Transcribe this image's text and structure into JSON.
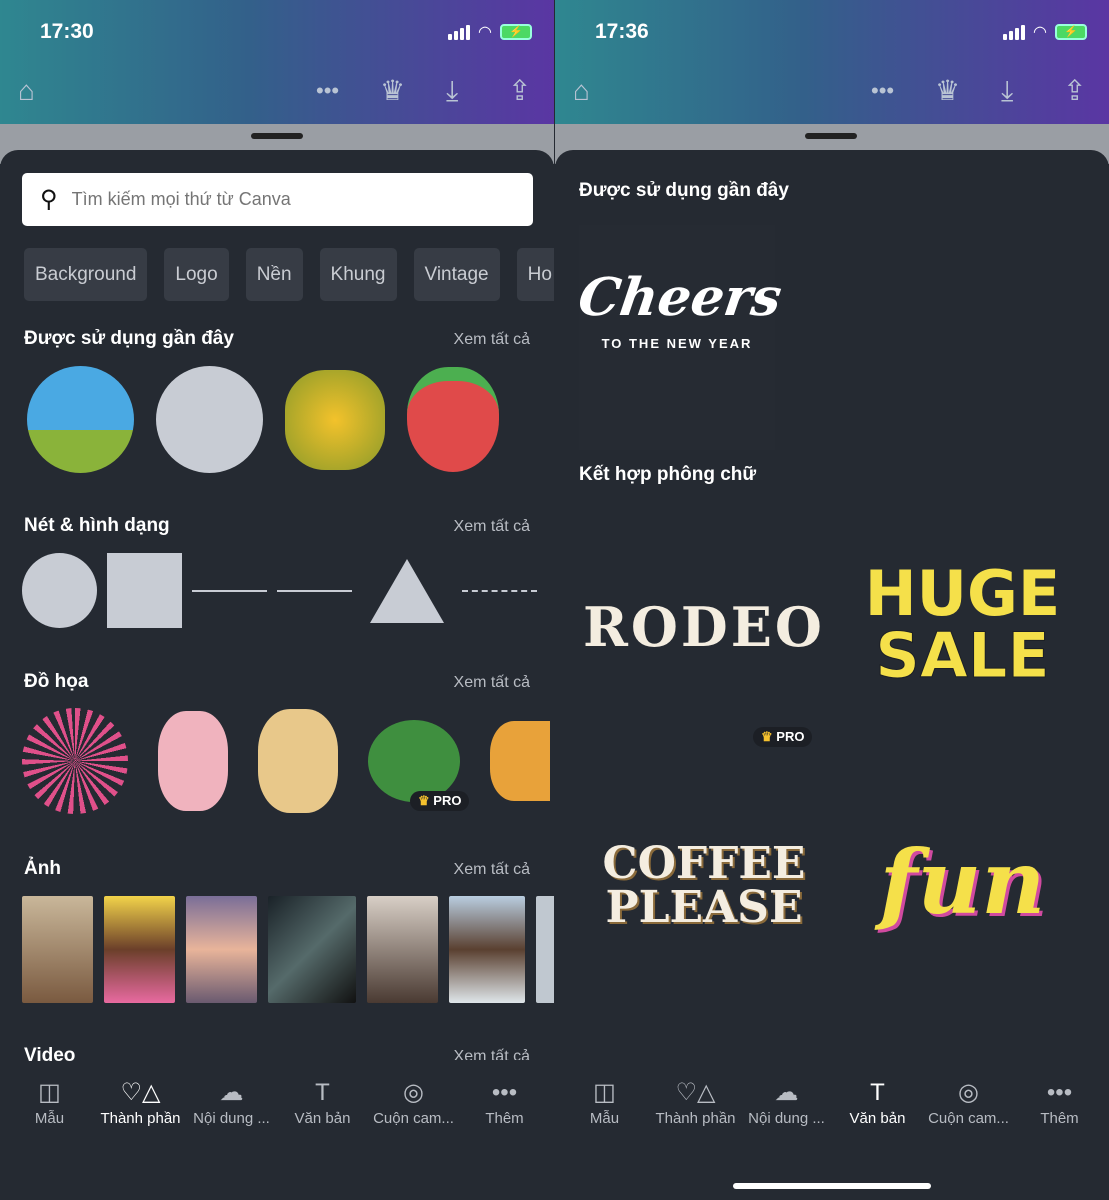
{
  "left": {
    "time": "17:30",
    "search_placeholder": "Tìm kiếm mọi thứ từ Canva",
    "chips": [
      "Background",
      "Logo",
      "Nền",
      "Khung",
      "Vintage",
      "Ho"
    ],
    "sections": [
      {
        "title": "Được sử dụng gần đây",
        "see_all": "Xem tất cả"
      },
      {
        "title": "Nét & hình dạng",
        "see_all": "Xem tất cả"
      },
      {
        "title": "Đồ họa",
        "see_all": "Xem tất cả"
      },
      {
        "title": "Ảnh",
        "see_all": "Xem tất cả"
      },
      {
        "title": "Video",
        "see_all": "Xem tất cả"
      }
    ],
    "pro_label": "PRO",
    "active_tab": "Thành phần"
  },
  "right": {
    "time": "17:36",
    "recent_title": "Được sử dụng gần đây",
    "cheers": "Cheers",
    "cheers_sub": "TO THE NEW YEAR",
    "font_combo_title": "Kết hợp phông chữ",
    "fonts": [
      "RODEO",
      "HUGE",
      "SALE",
      "COFFEE",
      "PLEASE",
      "fun"
    ],
    "pro_label": "PRO",
    "active_tab": "Văn bản"
  },
  "nav": [
    {
      "label": "Mẫu",
      "icon": "template-icon"
    },
    {
      "label": "Thành phần",
      "icon": "elements-icon"
    },
    {
      "label": "Nội dung ...",
      "icon": "upload-cloud-icon"
    },
    {
      "label": "Văn bản",
      "icon": "text-icon"
    },
    {
      "label": "Cuộn cam...",
      "icon": "camera-icon"
    },
    {
      "label": "Thêm",
      "icon": "more-icon"
    }
  ],
  "colors": {
    "accent_yellow": "#f5e04a",
    "sheet": "#252a32"
  }
}
